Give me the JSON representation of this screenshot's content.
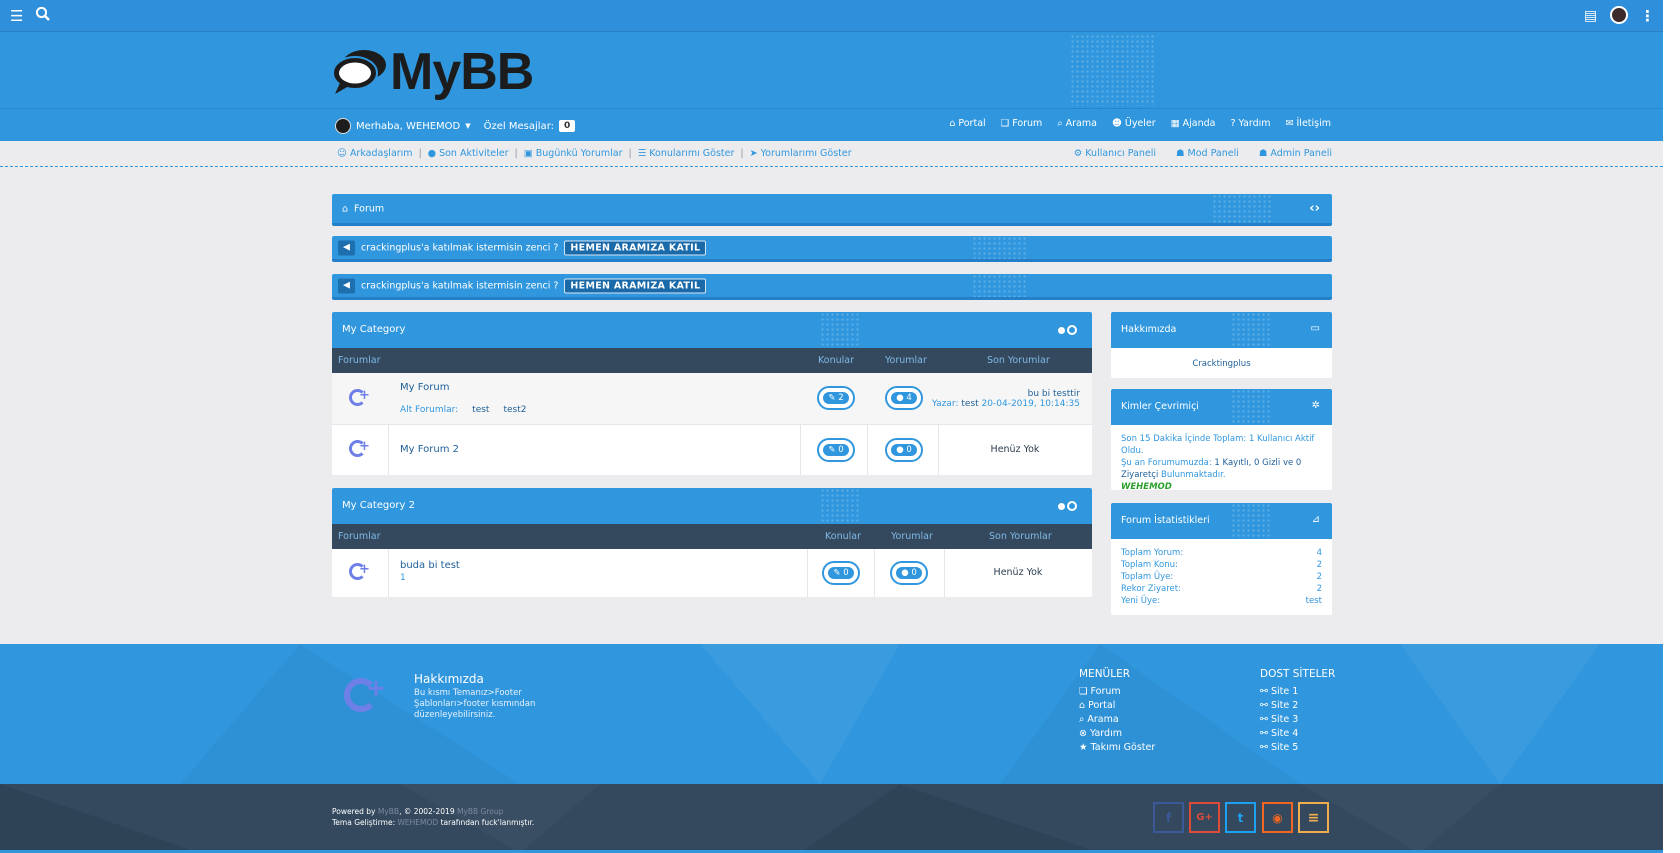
{
  "colors": {
    "primary": "#3097de",
    "dark": "#34495e",
    "accent": "#6e7fe8"
  },
  "header": {
    "logo_text": "MyBB"
  },
  "user_nav": {
    "greeting": "Merhaba, WEHEMOD",
    "pm_label": "Özel Mesajlar:",
    "pm_count": "0"
  },
  "main_nav": [
    {
      "icon": "home-icon",
      "label": "Portal"
    },
    {
      "icon": "forum-icon",
      "label": "Forum"
    },
    {
      "icon": "search-icon",
      "label": "Arama"
    },
    {
      "icon": "users-icon",
      "label": "Üyeler"
    },
    {
      "icon": "calendar-icon",
      "label": "Ajanda"
    },
    {
      "icon": "help-icon",
      "label": "Yardım"
    },
    {
      "icon": "contact-icon",
      "label": "İletişim"
    }
  ],
  "sub_nav": {
    "left": [
      {
        "icon": "friends-icon",
        "label": "Arkadaşlarım"
      },
      {
        "icon": "activity-icon",
        "label": "Son Aktiviteler"
      },
      {
        "icon": "today-icon",
        "label": "Bugünkü Yorumlar"
      },
      {
        "icon": "list-icon",
        "label": "Konularımı Göster"
      },
      {
        "icon": "send-icon",
        "label": "Yorumlarımı Göster"
      }
    ],
    "right": [
      {
        "icon": "user-cp-icon",
        "label": "Kullanıcı Paneli"
      },
      {
        "icon": "mod-icon",
        "label": "Mod Paneli"
      },
      {
        "icon": "admin-icon",
        "label": "Admin Paneli"
      }
    ]
  },
  "breadcrumb": {
    "label": "Forum"
  },
  "announcements": [
    {
      "text": "crackingplus'a katılmak istermisin zenci ?",
      "button": "HEMEN ARAMIZA KATIL"
    },
    {
      "text": "crackingplus'a katılmak istermisin zenci ?",
      "button": "HEMEN ARAMIZA KATIL"
    }
  ],
  "categories": [
    {
      "title": "My Category",
      "columns": {
        "forums": "Forumlar",
        "threads": "Konular",
        "posts": "Yorumlar",
        "last": "Son Yorumlar"
      },
      "rows": [
        {
          "name": "My Forum",
          "sub_label": "Alt Forumlar:",
          "subforums": [
            "test",
            "test2"
          ],
          "threads": "2",
          "posts": "4",
          "last_title": "bu bi testtir",
          "last_by_label": "Yazar:",
          "last_by": "test",
          "last_date": "20-04-2019, 10:14:35"
        },
        {
          "name": "My Forum 2",
          "threads": "0",
          "posts": "0",
          "last_none": "Henüz Yok"
        }
      ]
    },
    {
      "title": "My Category 2",
      "columns": {
        "forums": "Forumlar",
        "threads": "Konular",
        "posts": "Yorumlar",
        "last": "Son Yorumlar"
      },
      "rows": [
        {
          "name": "buda bi test",
          "desc": "1",
          "threads": "0",
          "posts": "0",
          "last_none": "Henüz Yok"
        }
      ]
    }
  ],
  "sidebar": {
    "about": {
      "title": "Hakkımızda",
      "body": "Cracktingplus"
    },
    "online": {
      "title": "Kimler Çevrimiçi",
      "line1": "Son 15 Dakika İçinde Toplam: 1 Kullanıcı Aktif Oldu.",
      "line2a": "Şu an Forumumuzda: ",
      "line2b": "1 Kayıtlı, 0 Gizli ve 0",
      "line3a": "Ziyaretçi",
      "line3b": "  Bulunmaktadır.",
      "user": "WEHEMOD"
    },
    "stats": {
      "title": "Forum İstatistikleri",
      "items": [
        {
          "label": "Toplam Yorum:",
          "value": "4"
        },
        {
          "label": "Toplam Konu:",
          "value": "2"
        },
        {
          "label": "Toplam Üye:",
          "value": "2"
        },
        {
          "label": "Rekor Ziyaret:",
          "value": "2"
        },
        {
          "label": "Yeni Üye:",
          "value": "test"
        }
      ]
    }
  },
  "footer": {
    "about_title": "Hakkımızda",
    "about_text": "Bu kısmı Temanız>Footer Şablonları>footer kısmından düzenleyebilirsiniz.",
    "menus_title": "MENÜLER",
    "menus": [
      {
        "icon": "forum-icon",
        "label": "Forum"
      },
      {
        "icon": "home-icon",
        "label": "Portal"
      },
      {
        "icon": "search-icon",
        "label": "Arama"
      },
      {
        "icon": "help-icon",
        "label": "Yardım"
      },
      {
        "icon": "star-icon",
        "label": "Takımı Göster"
      }
    ],
    "friends_title": "DOST SİTELER",
    "friends": [
      {
        "icon": "link-icon",
        "label": "Site 1"
      },
      {
        "icon": "link-icon",
        "label": "Site 2"
      },
      {
        "icon": "link-icon",
        "label": "Site 3"
      },
      {
        "icon": "link-icon",
        "label": "Site 4"
      },
      {
        "icon": "link-icon",
        "label": "Site 5"
      }
    ],
    "powered_prefix": "Powered by ",
    "powered_link": "MyBB",
    "powered_suffix": ", © 2002-2019 ",
    "group": "MyBB Group",
    "dev_prefix": "Tema Geliştirme: ",
    "dev_name": "WEHEMOD",
    "dev_suffix": " tarafından fuck'lanmıştır.",
    "social": [
      {
        "icon": "facebook-icon",
        "glyph": "f",
        "color": "#3b5998"
      },
      {
        "icon": "google-plus-icon",
        "glyph": "G+",
        "color": "#dd4b39"
      },
      {
        "icon": "twitter-icon",
        "glyph": "t",
        "color": "#1da1f2"
      },
      {
        "icon": "rss-icon",
        "glyph": "◉",
        "color": "#f26522"
      },
      {
        "icon": "list-icon",
        "glyph": "≡",
        "color": "#f0ad4e"
      }
    ]
  }
}
